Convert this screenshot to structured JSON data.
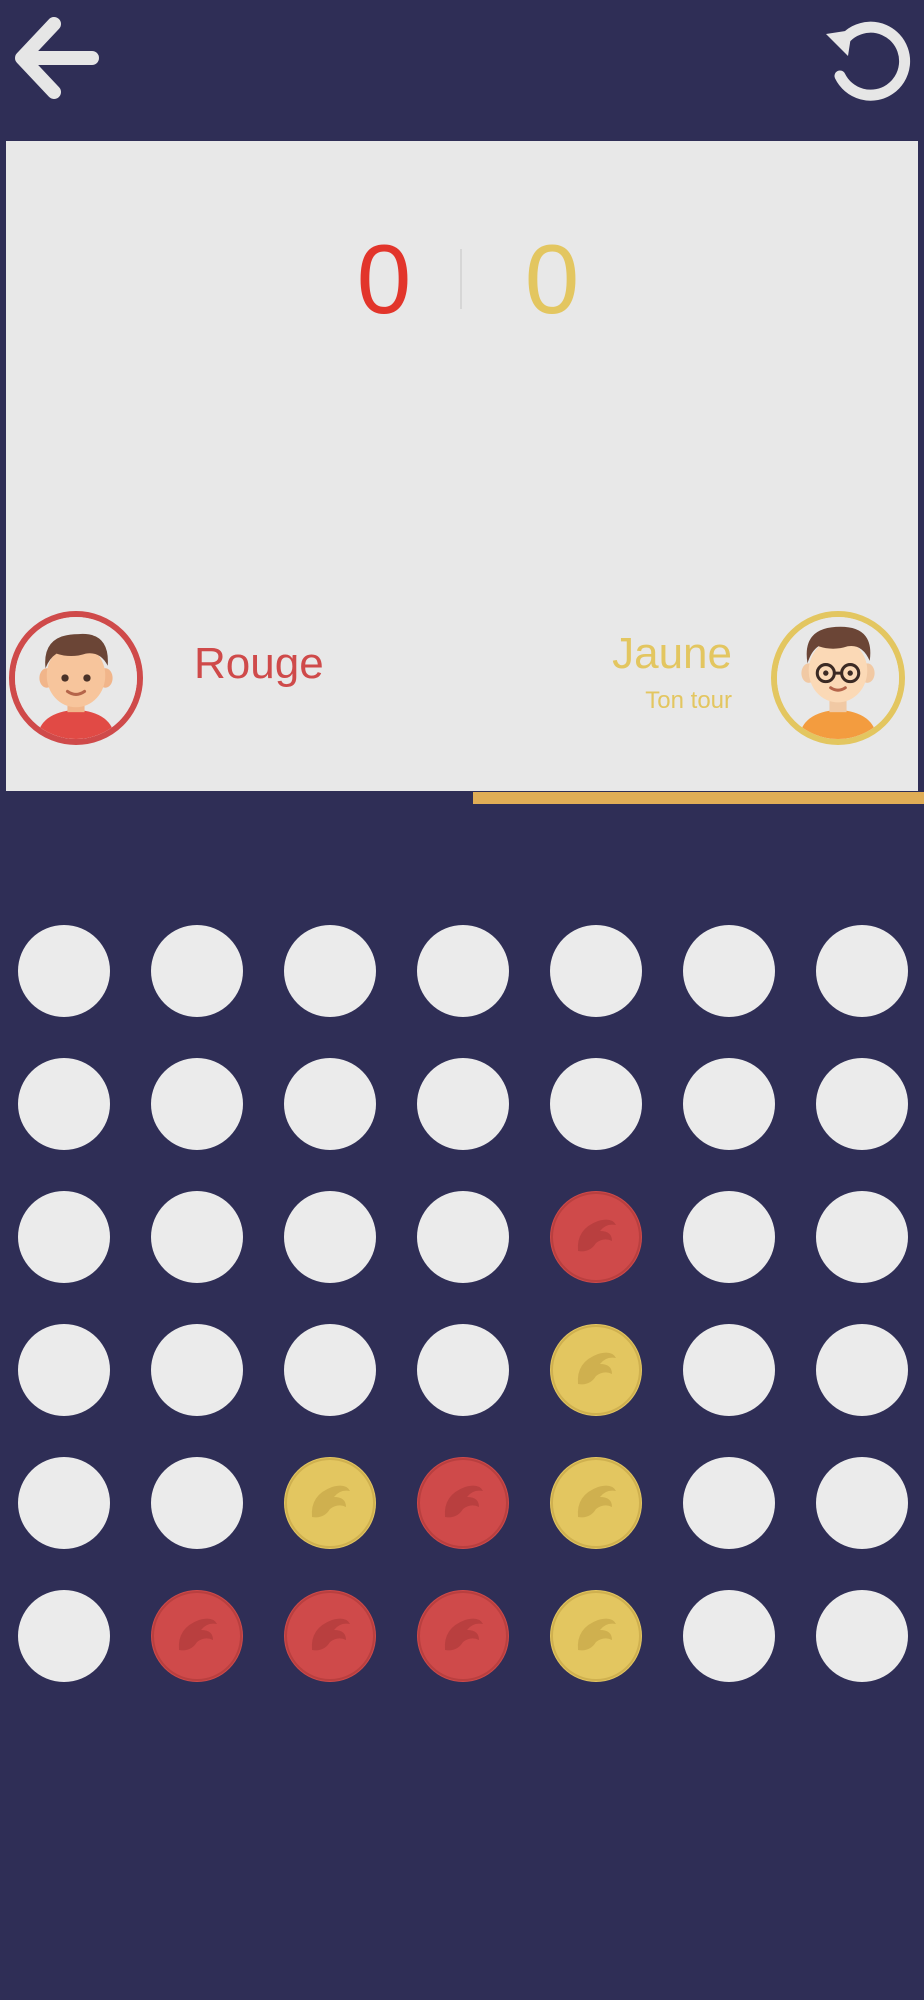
{
  "header": {
    "back_icon": "arrow-left-icon",
    "restart_icon": "restart-icon"
  },
  "scoreboard": {
    "red_score": "0",
    "yellow_score": "0"
  },
  "players": {
    "red": {
      "name": "Rouge",
      "avatar_icon": "boy-avatar-icon"
    },
    "yellow": {
      "name": "Jaune",
      "status": "Ton tour",
      "avatar_icon": "boy-glasses-avatar-icon"
    }
  },
  "colors": {
    "background": "#2f2e56",
    "panel": "#e8e8e8",
    "empty": "#ebebeb",
    "red": "#cf4a4a",
    "red_text": "#e2352b",
    "yellow": "#e3c660",
    "turn_bar": "#e0ad56"
  },
  "board": {
    "columns": 7,
    "rows": 6,
    "cells": [
      [
        "empty",
        "empty",
        "empty",
        "empty",
        "empty",
        "empty",
        "empty"
      ],
      [
        "empty",
        "empty",
        "empty",
        "empty",
        "empty",
        "empty",
        "empty"
      ],
      [
        "empty",
        "empty",
        "empty",
        "empty",
        "red",
        "empty",
        "empty"
      ],
      [
        "empty",
        "empty",
        "empty",
        "empty",
        "yellow",
        "empty",
        "empty"
      ],
      [
        "empty",
        "empty",
        "yellow",
        "red",
        "yellow",
        "empty",
        "empty"
      ],
      [
        "empty",
        "red",
        "red",
        "red",
        "yellow",
        "empty",
        "empty"
      ]
    ]
  }
}
